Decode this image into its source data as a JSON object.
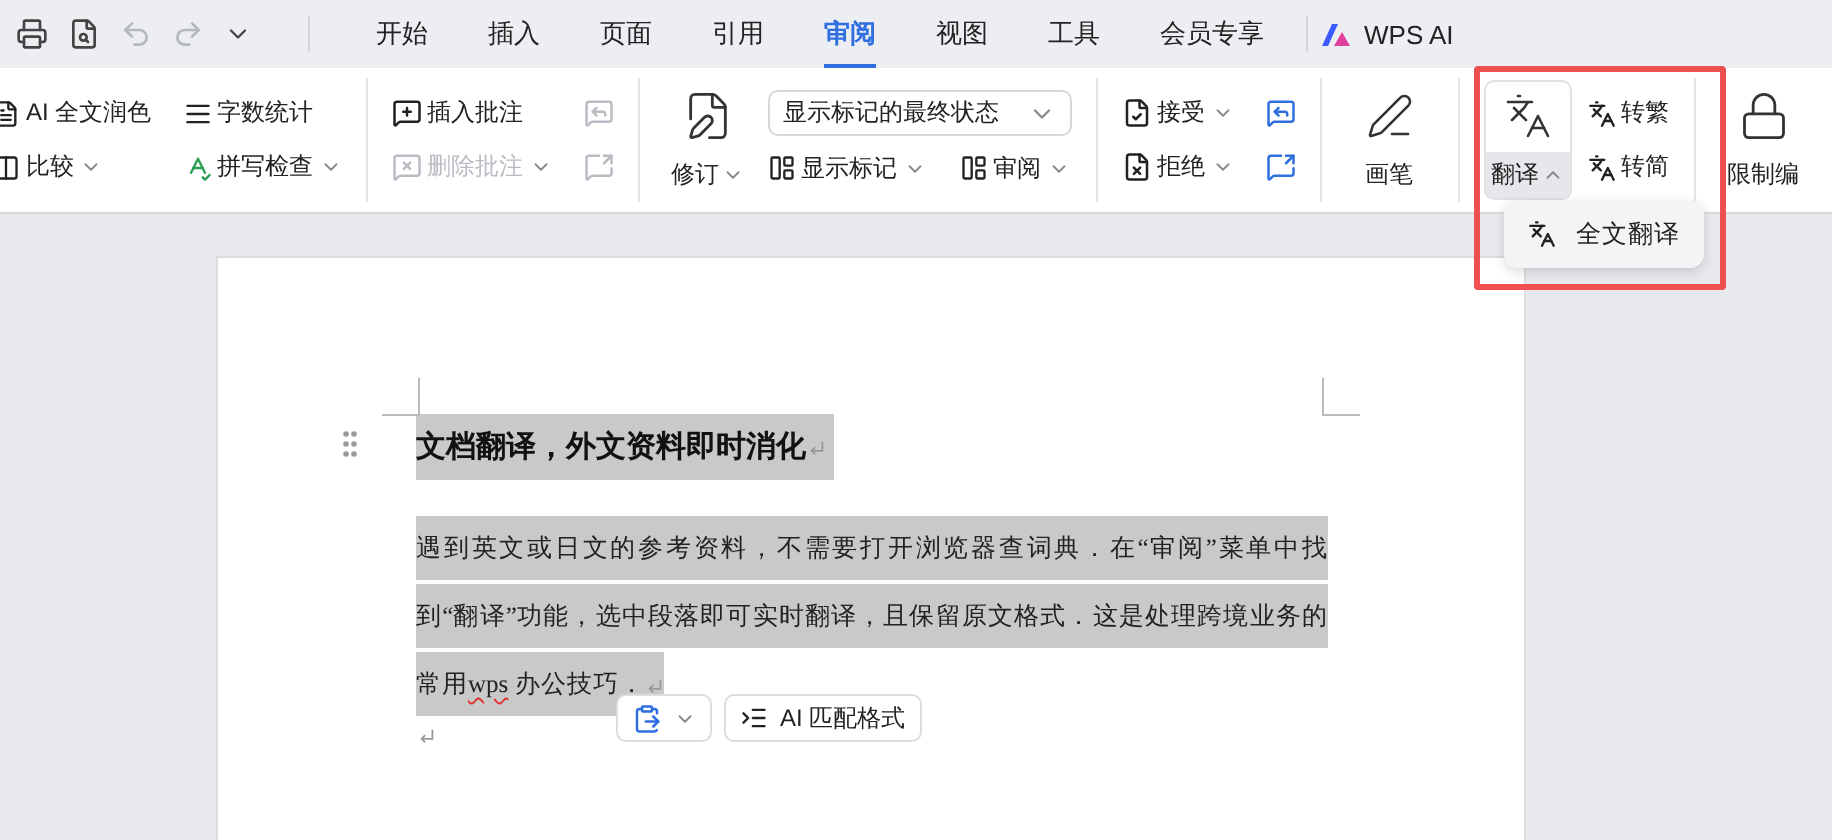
{
  "tabs": [
    {
      "label": "开始",
      "selected": false
    },
    {
      "label": "插入",
      "selected": false
    },
    {
      "label": "页面",
      "selected": false
    },
    {
      "label": "引用",
      "selected": false
    },
    {
      "label": "审阅",
      "selected": true
    },
    {
      "label": "视图",
      "selected": false
    },
    {
      "label": "工具",
      "selected": false
    },
    {
      "label": "会员专享",
      "selected": false
    }
  ],
  "ai_tab": {
    "label": "WPS AI"
  },
  "ribbon_groups": [
    {
      "rows": [
        [
          {
            "kind": "small",
            "label": "AI 全文润色",
            "dropdown": false,
            "disabled": false
          },
          {
            "kind": "small",
            "label": "字数统计",
            "dropdown": false,
            "disabled": false
          }
        ],
        [
          {
            "kind": "small",
            "label": "比较",
            "dropdown": true,
            "disabled": false
          },
          {
            "kind": "small",
            "label": "拼写检查",
            "dropdown": true,
            "disabled": false
          }
        ]
      ]
    },
    {
      "rows": [
        [
          {
            "kind": "small",
            "label": "插入批注",
            "dropdown": false,
            "disabled": false
          },
          {
            "kind": "icon",
            "disabled": true
          }
        ],
        [
          {
            "kind": "small",
            "label": "删除批注",
            "dropdown": true,
            "disabled": true
          },
          {
            "kind": "icon",
            "disabled": true
          }
        ]
      ]
    },
    {
      "large": {
        "label": "修订",
        "dropdown": true,
        "expanded": false
      },
      "rows": [
        [
          {
            "kind": "select",
            "label": "显示标记的最终状态",
            "disabled": false
          }
        ],
        [
          {
            "kind": "small",
            "label": "显示标记",
            "dropdown": true,
            "disabled": false
          },
          {
            "kind": "small",
            "label": "审阅",
            "dropdown": true,
            "disabled": false
          }
        ]
      ]
    },
    {
      "rows": [
        [
          {
            "kind": "small",
            "label": "接受",
            "dropdown": true,
            "disabled": false
          },
          {
            "kind": "icon",
            "disabled": false
          }
        ],
        [
          {
            "kind": "small",
            "label": "拒绝",
            "dropdown": true,
            "disabled": false
          },
          {
            "kind": "icon",
            "disabled": false
          }
        ]
      ]
    },
    {
      "large": {
        "label": "画笔",
        "dropdown": false,
        "expanded": false
      }
    },
    {
      "large": {
        "label": "翻译",
        "dropdown": true,
        "expanded": true
      },
      "rows": [
        [
          {
            "kind": "small",
            "label": "转繁",
            "dropdown": false,
            "disabled": false
          }
        ],
        [
          {
            "kind": "small",
            "label": "转简",
            "dropdown": false,
            "disabled": false
          }
        ]
      ]
    },
    {
      "large": {
        "label": "限制编",
        "dropdown": false,
        "expanded": false
      }
    }
  ],
  "translate_menu": {
    "items": [
      {
        "label": "全文翻译"
      }
    ]
  },
  "document": {
    "paragraphs": [
      {
        "kind": "heading",
        "selected": true,
        "runs": [
          {
            "text": "文档翻译，外文资料即时消化",
            "misspelled": false
          }
        ]
      },
      {
        "kind": "body",
        "selected": true,
        "runs": [
          {
            "text": "遇到英文或日文的参考资料，不需要打开浏览器查词典．在“审阅”菜单中找到“翻译”功能，选中段落即可实时翻译，且保留原文格式．这是处理跨境业务的常用",
            "misspelled": false
          },
          {
            "text": "wps",
            "misspelled": true
          },
          {
            "text": " 办公技巧．",
            "misspelled": false
          }
        ]
      },
      {
        "kind": "empty",
        "selected": false
      }
    ]
  },
  "float_toolbar": {
    "buttons": [
      {
        "kind": "paste"
      },
      {
        "kind": "ai_format",
        "label": "AI 匹配格式"
      }
    ]
  }
}
